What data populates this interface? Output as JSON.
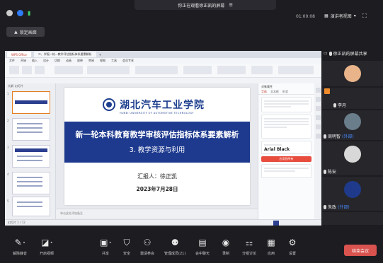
{
  "meeting": {
    "sharing_banner": "你正在观看徐正凯的屏幕",
    "timer": "01:00:08",
    "layout_label": "演讲者视图",
    "lock_label": "锁定画面"
  },
  "shared_screen": {
    "app_tabs": [
      "WPS Office",
      "二、学报一轮...教学评估指标体系要素解析"
    ],
    "menu_items": [
      "文件",
      "开始",
      "插入",
      "设计",
      "切换",
      "动画",
      "放映",
      "审阅",
      "视图",
      "工具",
      "会员专享"
    ],
    "thumb_tabs": [
      "大纲",
      "幻灯片"
    ],
    "slide": {
      "school_name": "湖北汽车工业学院",
      "school_en": "HUBEI UNIVERSITY OF AUTOMOTIVE TECHNOLOGY",
      "title": "新一轮本科教育教学审核评估指标体系要素解析",
      "subtitle": "3. 教学资源与利用",
      "reporter": "汇报人：徐正凯",
      "date": "2023年7月28日"
    },
    "notes_placeholder": "单击此处添加备注",
    "status_left": "幻灯片 1 / 12",
    "side_panel": {
      "header": "对象属性",
      "tabs": [
        "字体",
        "文本框",
        "形状"
      ],
      "font_name": "Arial Black",
      "apply_button": "应用到所有"
    }
  },
  "participants": [
    {
      "name": "徐正凯的屏幕共享",
      "tag": "",
      "avatar_color": "#1d1d21",
      "top_row": true
    },
    {
      "name": "",
      "tag": "",
      "avatar_color": "#e9b48a"
    },
    {
      "name": "李月",
      "tag": "",
      "avatar_color": "#2e3d5a"
    },
    {
      "name": "周明智",
      "tag": "(外部)",
      "avatar_color": "#6a7d8a"
    },
    {
      "name": "陈安",
      "tag": "",
      "avatar_color": "#d8d8d8"
    },
    {
      "name": "朱政",
      "tag": "(外部)",
      "avatar_color": "#1f3a8a"
    }
  ],
  "toolbar": {
    "mute": "解除静音",
    "video": "开启视频",
    "share": "共享",
    "security": "安全",
    "invite": "邀请参会",
    "members": "管理成员(21)",
    "chat": "会中聊天",
    "record": "录制",
    "breakout": "分组讨论",
    "apps": "应用",
    "settings": "设置",
    "end": "结束会议"
  },
  "colors": {
    "banner": "#1e3a8a",
    "end_button": "#d9534f",
    "accent_blue": "#4a8cff"
  }
}
